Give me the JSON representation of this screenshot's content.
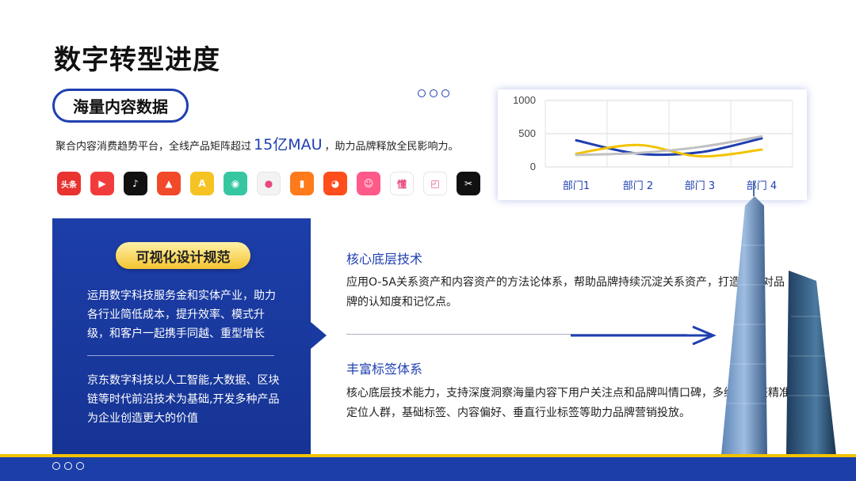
{
  "page": {
    "title": "数字转型进度"
  },
  "top_section": {
    "pill_label": "海量内容数据",
    "desc_before": "聚合内容消费趋势平台，全线产品矩阵超过",
    "desc_highlight": "15亿MAU",
    "desc_after": "，助力品牌释放全民影响力。",
    "apps": [
      {
        "name": "toutiao-icon",
        "glyph": "头条",
        "color": "#e8332f"
      },
      {
        "name": "xigua-icon",
        "glyph": "▶",
        "color": "#f23c3c"
      },
      {
        "name": "douyin-icon",
        "glyph": "♪",
        "color": "#111111"
      },
      {
        "name": "huoshan-icon",
        "glyph": "▲",
        "color": "#f04a2a"
      },
      {
        "name": "fanqie-icon",
        "glyph": "A",
        "color": "#f5c322"
      },
      {
        "name": "panda-icon",
        "glyph": "◉",
        "color": "#36c7a0"
      },
      {
        "name": "circle-app-icon",
        "glyph": "●",
        "color": "#f3f3f3"
      },
      {
        "name": "book-app-icon",
        "glyph": "▮",
        "color": "#ff7a1a"
      },
      {
        "name": "tomato-icon",
        "glyph": "◕",
        "color": "#ff4d1c"
      },
      {
        "name": "pipixia-icon",
        "glyph": "☺",
        "color": "#ff5a8a"
      },
      {
        "name": "dongchedi-icon",
        "glyph": "懂",
        "color": "#ffffff"
      },
      {
        "name": "frame-app-icon",
        "glyph": "◰",
        "color": "#ffffff"
      },
      {
        "name": "capcut-icon",
        "glyph": "✂",
        "color": "#111111"
      }
    ]
  },
  "chart_data": {
    "type": "line",
    "categories": [
      "部门1",
      "部门 2",
      "部门 3",
      "部门 4"
    ],
    "ylim": [
      0,
      1000
    ],
    "yticks": [
      "0",
      "500",
      "1000"
    ],
    "grid": true,
    "series": [
      {
        "values": [
          400,
          200,
          220,
          430
        ],
        "color": "#1f3fb0"
      },
      {
        "values": [
          200,
          330,
          160,
          260
        ],
        "color": "#f2c300"
      },
      {
        "values": [
          180,
          210,
          300,
          460
        ],
        "color": "#c0c0c0"
      }
    ]
  },
  "panel": {
    "pill_label": "可视化设计规范",
    "text1": "运用数字科技服务金和实体产业，助力各行业简低成本，提升效率、模式升级，和客户一起携手同越、重型增长",
    "text2": "京东数字科技以人工智能,大数据、区块链等时代前沿技术为基础,开发多种产品为企业创造更大的价值"
  },
  "sections": [
    {
      "title": "核心底层技术",
      "body": "应用O-5A关系资产和内容资产的方法论体系，帮助品牌持续沉淀关系资产，打造大众对品牌的认知度和记忆点。"
    },
    {
      "title": "丰富标签体系",
      "body": "核心底层技术能力，支持深度洞察海量内容下用户关注点和品牌叫情口碑，多纬度标签精准定位人群，基础标签、内容偏好、垂直行业标签等助力品牌营销投放。"
    }
  ],
  "colors": {
    "brand_blue": "#1f3fb0",
    "gold": "#f2c300"
  }
}
